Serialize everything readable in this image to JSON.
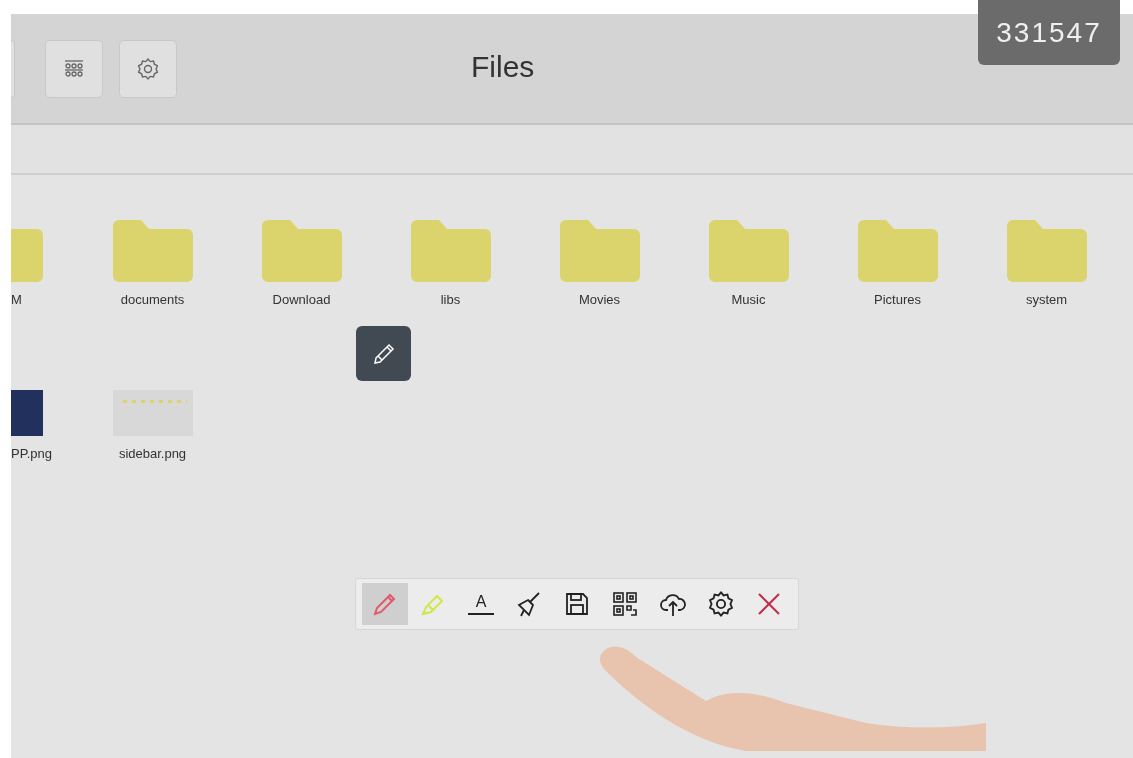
{
  "header": {
    "buttons": [
      {
        "kind": "edge"
      },
      {
        "kind": "grid"
      },
      {
        "kind": "settings"
      }
    ],
    "title": "Files",
    "badge": "331547"
  },
  "folders": [
    {
      "name": "M",
      "cut": true
    },
    {
      "name": "documents",
      "cut": false
    },
    {
      "name": "Download",
      "cut": false
    },
    {
      "name": "libs",
      "cut": false
    },
    {
      "name": "Movies",
      "cut": false
    },
    {
      "name": "Music",
      "cut": false
    },
    {
      "name": "Pictures",
      "cut": false
    },
    {
      "name": "system",
      "cut": false
    }
  ],
  "files": [
    {
      "name": "PP.png",
      "kind": "dark",
      "cut": true
    },
    {
      "name": "sidebar.png",
      "kind": "light",
      "cut": false
    }
  ],
  "toolbar": [
    {
      "kind": "pen",
      "selected": true
    },
    {
      "kind": "highlighter",
      "selected": false
    },
    {
      "kind": "text",
      "label": "A",
      "selected": false
    },
    {
      "kind": "eraser",
      "selected": false
    },
    {
      "kind": "save",
      "selected": false
    },
    {
      "kind": "qr",
      "selected": false
    },
    {
      "kind": "upload",
      "selected": false
    },
    {
      "kind": "settings",
      "selected": false
    },
    {
      "kind": "close",
      "selected": false
    }
  ]
}
